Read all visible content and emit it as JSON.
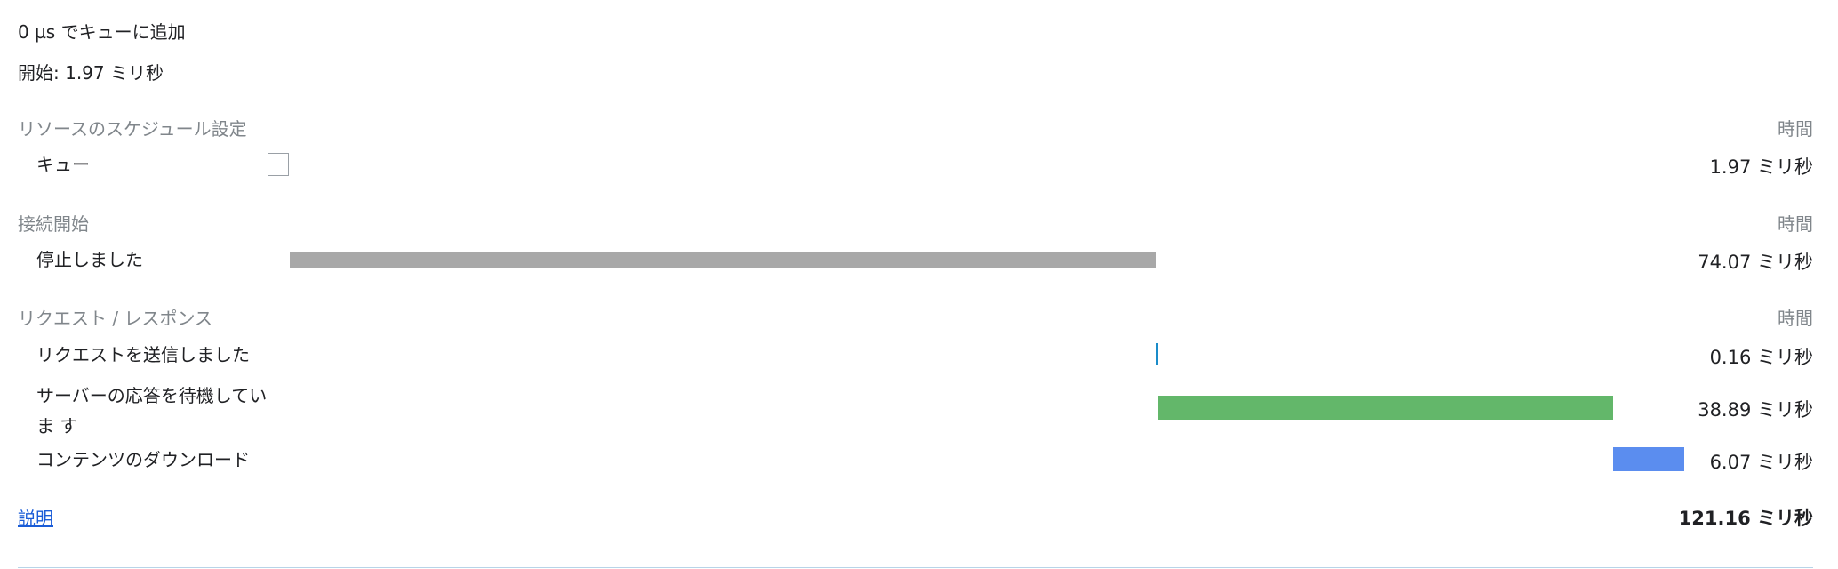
{
  "queued_text": "0 µs でキューに追加",
  "started_text": "開始: 1.97 ミリ秒",
  "time_header": "時間",
  "sections": {
    "scheduling": {
      "title": "リソースのスケジュール設定",
      "rows": [
        {
          "label": "キュー",
          "value": "1.97 ミリ秒"
        }
      ]
    },
    "connection": {
      "title": "接続開始",
      "rows": [
        {
          "label": "停止しました",
          "value": "74.07 ミリ秒",
          "color": "#a8a8a8"
        }
      ]
    },
    "request": {
      "title": "リクエスト / レスポンス",
      "rows": [
        {
          "label": "リクエストを送信しました",
          "value": "0.16 ミリ秒",
          "color": "#1a8cc9"
        },
        {
          "label": "サーバーの応答を待機していま す",
          "value": "38.89 ミリ秒",
          "color": "#63b76a"
        },
        {
          "label": "コンテンツのダウンロード",
          "value": "6.07 ミリ秒",
          "color": "#5b8def"
        }
      ]
    }
  },
  "footer": {
    "explanation_link": "説明",
    "total": "121.16 ミリ秒"
  }
}
